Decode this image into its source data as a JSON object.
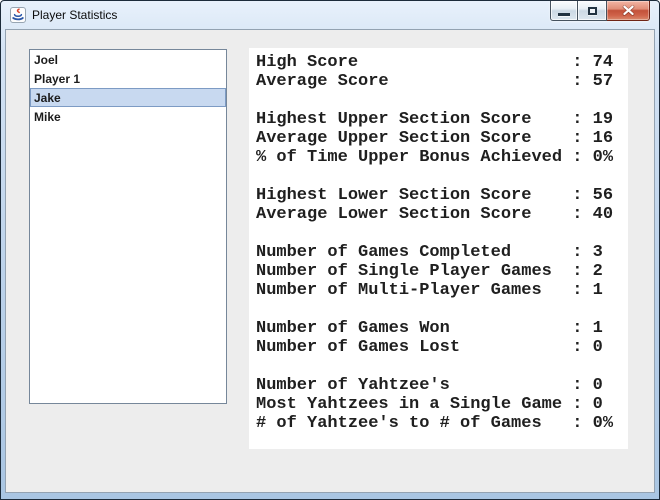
{
  "window": {
    "title": "Player Statistics"
  },
  "icons": {
    "app": "java-coffee-cup",
    "minimize": "minimize-bar",
    "maximize": "maximize-square",
    "close": "close-x"
  },
  "players": {
    "items": [
      "Joel",
      "Player 1",
      "Jake",
      "Mike"
    ],
    "selected_index": 2,
    "selected_name": "Jake"
  },
  "stats": {
    "label_pad": 30,
    "separator": ":",
    "groups": [
      [
        {
          "label": "High Score",
          "value": "74"
        },
        {
          "label": "Average Score",
          "value": "57"
        }
      ],
      [
        {
          "label": "Highest Upper Section Score",
          "value": "19"
        },
        {
          "label": "Average Upper Section Score",
          "value": "16"
        },
        {
          "label": "% of Time Upper Bonus Achieved",
          "value": "0%"
        }
      ],
      [
        {
          "label": "Highest Lower Section Score",
          "value": "56"
        },
        {
          "label": "Average Lower Section Score",
          "value": "40"
        }
      ],
      [
        {
          "label": "Number of Games Completed",
          "value": "3"
        },
        {
          "label": "Number of Single Player Games",
          "value": "2"
        },
        {
          "label": "Number of Multi-Player Games",
          "value": "1"
        }
      ],
      [
        {
          "label": "Number of Games Won",
          "value": "1"
        },
        {
          "label": "Number of Games Lost",
          "value": "0"
        }
      ],
      [
        {
          "label": "Number of Yahtzee's",
          "value": "0"
        },
        {
          "label": "Most Yahtzees in a Single Game",
          "value": "0"
        },
        {
          "label": "# of Yahtzee's to # of Games",
          "value": "0%"
        }
      ]
    ]
  },
  "colors": {
    "titlebar_top": "#e8f1fb",
    "titlebar_bottom": "#a9c5e2",
    "client_bg": "#ededed",
    "list_border": "#76879a",
    "selection_bg": "#c8d9f0",
    "selection_border": "#7d9bc4",
    "close_button_red": "#c2513a",
    "text": "#1f1f1f"
  }
}
